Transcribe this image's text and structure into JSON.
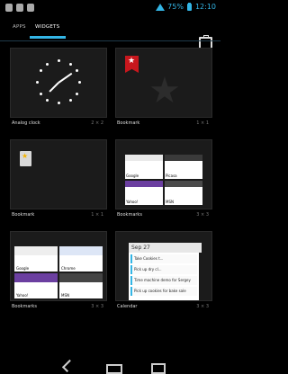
{
  "statusbar": {
    "battery_text": "75%",
    "time": "12:10"
  },
  "tabs": {
    "apps": "APPS",
    "widgets": "WIDGETS"
  },
  "widgets": [
    {
      "label": "Analog clock",
      "size": "2 × 2"
    },
    {
      "label": "Bookmark",
      "size": "1 × 1"
    },
    {
      "label": "Bookmark",
      "size": "1 × 1"
    },
    {
      "label": "Bookmarks",
      "size": "3 × 3"
    },
    {
      "label": "Bookmarks",
      "size": "3 × 3"
    },
    {
      "label": "Calendar",
      "size": "3 × 3"
    }
  ],
  "thumbnails": {
    "google": "Google",
    "picasa": "Picasa",
    "yahoo": "Yahoo!",
    "msn": "MSN",
    "chrome": "Chrome"
  },
  "calendar": {
    "date": "Sep 27",
    "events": [
      "Take Cookies t...",
      "Pick up dry cl...",
      "Time machine demo for Sergey",
      "Pick up cookies for bake sale"
    ]
  }
}
